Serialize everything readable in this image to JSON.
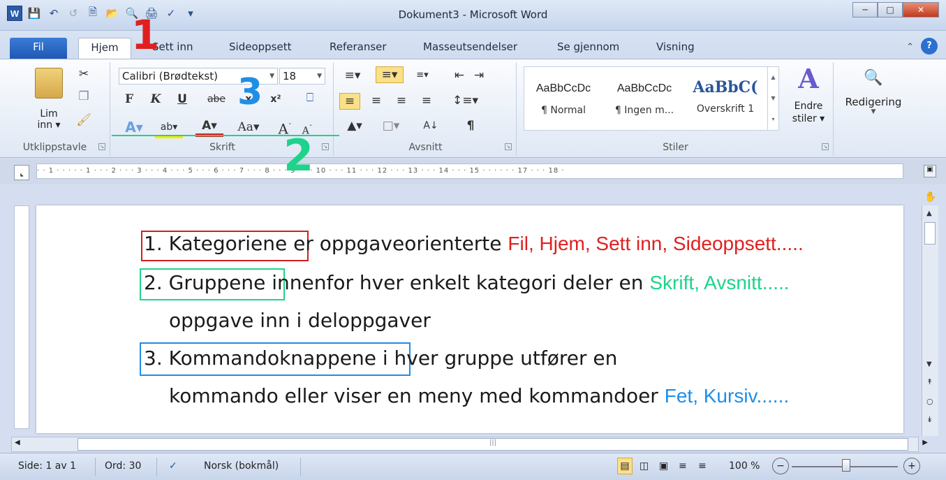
{
  "window": {
    "title": "Dokument3 - Microsoft Word",
    "app_icon": "W"
  },
  "qat": {
    "icons": [
      "word-logo",
      "save-icon",
      "undo-icon",
      "redo-icon",
      "new-doc-icon",
      "open-icon",
      "print-preview-icon",
      "print-icon",
      "spellcheck-icon",
      "customize-icon"
    ]
  },
  "tabs": [
    "Fil",
    "Hjem",
    "Sett inn",
    "Sideoppsett",
    "Referanser",
    "Masseutsendelser",
    "Se gjennom",
    "Visning"
  ],
  "ribbon": {
    "clipboard": {
      "paste_label": "Lim",
      "paste_label2": "inn",
      "group": "Utklippstavle"
    },
    "font": {
      "font_name": "Calibri (Brødtekst)",
      "font_size": "18",
      "bold": "F",
      "italic": "K",
      "underline": "U",
      "strike": "abe",
      "sub": "x₂",
      "sup": "x²",
      "change_case": "Aa",
      "grow": "A",
      "shrink": "A",
      "group": "Skrift"
    },
    "paragraph": {
      "pilcrow": "¶",
      "group": "Avsnitt"
    },
    "styles": {
      "items": [
        {
          "preview": "AaBbCcDc",
          "name": "¶ Normal"
        },
        {
          "preview": "AaBbCcDc",
          "name": "¶ Ingen m..."
        },
        {
          "preview": "AaBbC(",
          "name": "Overskrift 1"
        }
      ],
      "change_label": "Endre",
      "change_label2": "stiler",
      "group": "Stiler"
    },
    "editing": {
      "label": "Redigering"
    }
  },
  "ruler": {
    "marks": "· · 1 · · · · · 1 · · · 2 · · · 3 · · · 4 · · · 5 · · · 6 · · · 7 · · · 8 · · · 9 · · · 10 · · · 11 · · · 12 · · · 13 · · · 14 · · · 15 · · · · · · 17 · · · 18 ·"
  },
  "document": {
    "l1_boxed": "1. Kategoriene",
    "l1_rest": " er oppgaveorienterte ",
    "l1_example": "Fil, Hjem, Sett inn, Sideoppsett.....",
    "l2_boxed": "2. Gruppene",
    "l2_rest": " innenfor hver enkelt kategori deler en ",
    "l2_example": "Skrift, Avsnitt.....",
    "l3": "oppgave inn i deloppgaver",
    "l4_boxed": "3. Kommandoknappene",
    "l4_rest": " i hver gruppe utfører en",
    "l5_rest": "kommando eller viser en meny med kommandoer ",
    "l5_example": "Fet, Kursiv......"
  },
  "annotations": {
    "n1": "1",
    "n2": "2",
    "n3": "3",
    "colors": {
      "n1": "#e02020",
      "n2": "#1fd38a",
      "n3": "#1f8ee6"
    }
  },
  "status": {
    "page": "Side: 1 av 1",
    "words": "Ord: 30",
    "language": "Norsk (bokmål)",
    "zoom": "100 %"
  }
}
